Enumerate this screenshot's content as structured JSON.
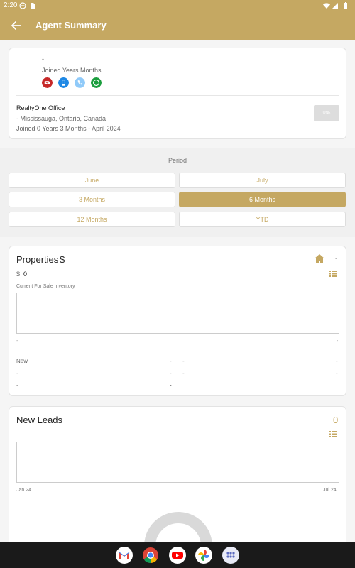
{
  "status_bar": {
    "time": "2:20"
  },
  "app_bar": {
    "title": "Agent Summary"
  },
  "agent": {
    "name": "-",
    "joined": "Joined Years Months",
    "office_name": "RealtyOne Office",
    "office_location": " - Mississauga,  Ontario,  Canada",
    "office_joined": "Joined 0 Years 3 Months - April 2024",
    "office_logo_text": "ONE"
  },
  "period": {
    "label": "Period",
    "options": [
      "June",
      "July",
      "3 Months",
      "6 Months",
      "12 Months",
      "YTD"
    ],
    "selected": "6 Months"
  },
  "properties": {
    "title": "Properties",
    "currency_symbol": "$",
    "header_value": "-",
    "small_currency": "$",
    "amount": "0",
    "inventory_label": "Current For Sale Inventory",
    "axis_left": "-",
    "axis_right": "-",
    "stats_label_new": "New",
    "stats_dash": "-"
  },
  "leads": {
    "title": "New Leads",
    "count": "0",
    "x_start": "Jan 24",
    "x_end": "Jul 24"
  },
  "colors": {
    "accent": "#c5a862",
    "background": "#f5f5f5",
    "nav": "#1a1a1a"
  },
  "dock": {
    "apps": [
      "gmail-icon",
      "chrome-icon",
      "youtube-icon",
      "photos-icon",
      "app-drawer-icon"
    ]
  }
}
